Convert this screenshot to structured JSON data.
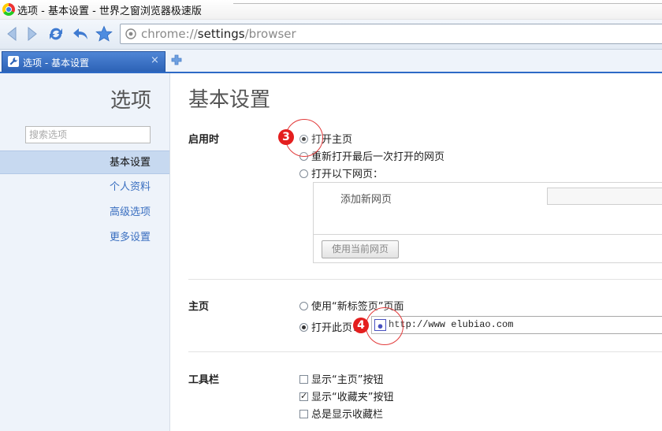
{
  "window": {
    "title": "选项 - 基本设置 - 世界之窗浏览器极速版",
    "app_icon": "chrome-style-browser-icon"
  },
  "toolbar": {
    "back_icon": "back-arrow-icon",
    "forward_icon": "forward-arrow-icon",
    "refresh_icon": "refresh-icon",
    "undo_icon": "undo-arrow-icon",
    "bookmark_icon": "star-icon",
    "address": {
      "scheme": "chrome://",
      "host": "settings",
      "path": "/browser"
    }
  },
  "tabs": [
    {
      "label": "选项 - 基本设置",
      "close": "×",
      "active": true
    }
  ],
  "sidebar": {
    "title": "选项",
    "search_placeholder": "搜索选项",
    "items": [
      {
        "label": "基本设置",
        "active": true
      },
      {
        "label": "个人资料",
        "active": false
      },
      {
        "label": "高级选项",
        "active": false
      },
      {
        "label": "更多设置",
        "active": false
      }
    ]
  },
  "main": {
    "title": "基本设置",
    "startup": {
      "label": "启用时",
      "options": [
        "打开主页",
        "重新打开最后一次打开的网页",
        "打开以下网页："
      ],
      "selected": 0,
      "add_page_label": "添加新网页",
      "use_current_button": "使用当前网页"
    },
    "homepage": {
      "label": "主页",
      "options": [
        "使用“新标签页”页面",
        "打开此页："
      ],
      "selected": 1,
      "url": "http://www  elubiao.com"
    },
    "toolbar_section": {
      "label": "工具栏",
      "options": [
        {
          "label": "显示“主页”按钮",
          "checked": false
        },
        {
          "label": "显示“收藏夹”按钮",
          "checked": true
        },
        {
          "label": "总是显示收藏栏",
          "checked": false
        }
      ]
    }
  },
  "annotations": {
    "badge_3": "3",
    "badge_4": "4",
    "color": "#e41e1e"
  }
}
